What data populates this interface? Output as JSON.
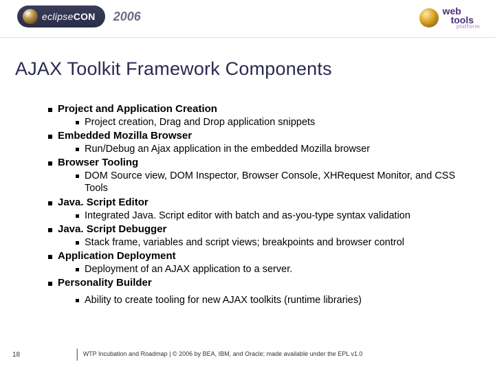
{
  "header": {
    "brand_left": "eclipse",
    "brand_left_suffix": "CON",
    "year": "2006",
    "brand_right_top": "web",
    "brand_right_bottom": "tools",
    "brand_right_sub": "platform"
  },
  "title": "AJAX Toolkit Framework Components",
  "items": [
    {
      "label": "Project and Application Creation",
      "sub": "Project creation, Drag and Drop application snippets"
    },
    {
      "label": "Embedded Mozilla Browser",
      "sub": "Run/Debug an Ajax application in the embedded Mozilla browser"
    },
    {
      "label": "Browser Tooling",
      "sub": "DOM Source view, DOM Inspector, Browser Console, XHRequest Monitor, and CSS Tools"
    },
    {
      "label": "Java. Script Editor",
      "sub": "Integrated Java. Script editor with batch and as-you-type syntax validation"
    },
    {
      "label": "Java. Script Debugger",
      "sub": "Stack frame, variables and script views; breakpoints and browser control"
    },
    {
      "label": "Application Deployment",
      "sub": "Deployment of an AJAX application to a server."
    },
    {
      "label": "Personality Builder",
      "sub": "Ability to create tooling for new AJAX toolkits (runtime libraries)"
    }
  ],
  "footer": {
    "page": "18",
    "text": "WTP Incubation and Roadmap  |  © 2006 by BEA, IBM, and Oracle; made available under the EPL v1.0"
  }
}
